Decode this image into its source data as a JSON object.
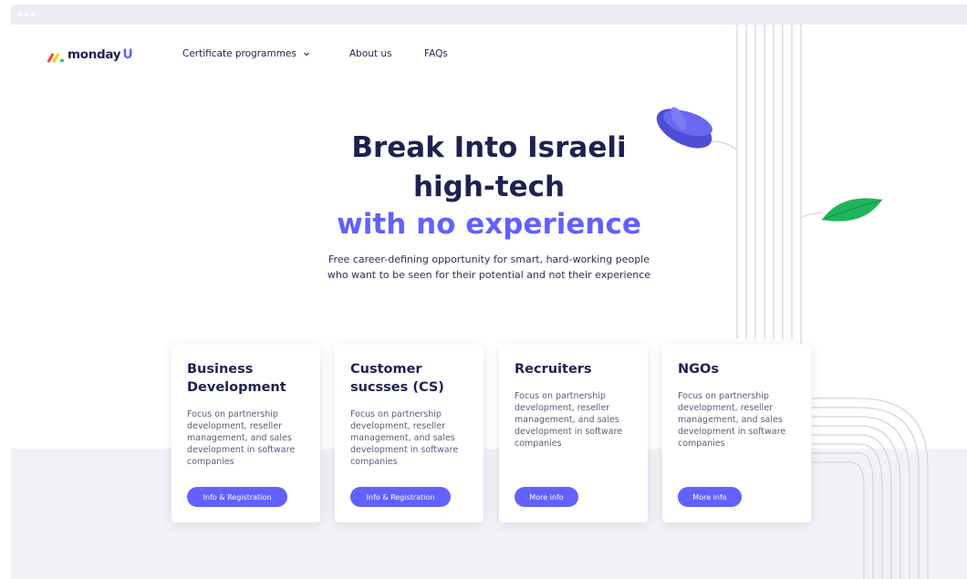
{
  "brand": {
    "name": "monday",
    "suffix": "U"
  },
  "nav": {
    "programmes": "Certificate programmes",
    "about": "About us",
    "faqs": "FAQs"
  },
  "hero": {
    "line1": "Break Into Israeli",
    "line2": "high-tech",
    "line3": "with no experience",
    "sub1": "Free career-defining opportunity for smart, hard-working people",
    "sub2": "who want to be seen for their potential and not their experience"
  },
  "cards": [
    {
      "title": "Business Development",
      "desc": "Focus on partnership development, reseller management, and sales development in software companies",
      "button": "Info & Registration"
    },
    {
      "title": "Customer sucsses (CS)",
      "desc": "Focus on partnership development, reseller management, and sales development in software companies",
      "button": "Info & Registration"
    },
    {
      "title": "Recruiters",
      "desc": "Focus on partnership development, reseller management, and sales development in software companies",
      "button": "More info"
    },
    {
      "title": "NGOs",
      "desc": "Focus on partnership development, reseller management, and sales development in software companies",
      "button": "More info"
    }
  ],
  "colors": {
    "brand_purple": "#6161ff",
    "navy": "#1f2150",
    "leaf_green": "#1fb45a",
    "petal_blue": "#5a5ae6",
    "band": "#f2f2f6"
  }
}
